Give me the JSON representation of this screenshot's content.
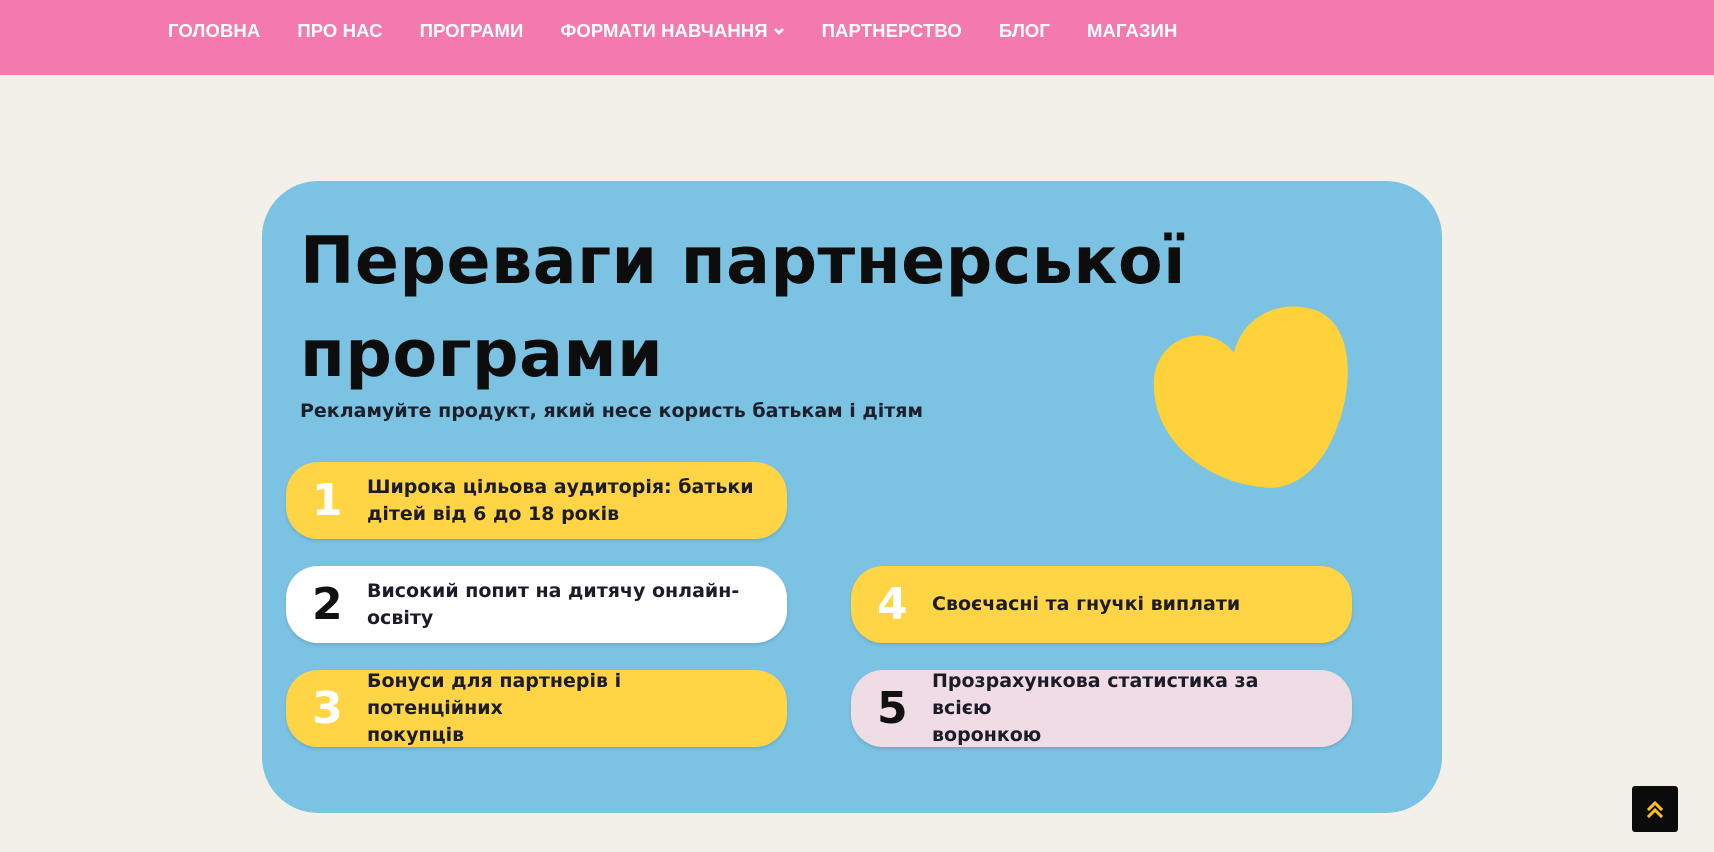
{
  "nav": {
    "items": [
      {
        "label": "ГОЛОВНА",
        "name": "nav-item-home",
        "dropdown": false
      },
      {
        "label": "ПРО НАС",
        "name": "nav-item-about",
        "dropdown": false
      },
      {
        "label": "ПРОГРАМИ",
        "name": "nav-item-programs",
        "dropdown": false
      },
      {
        "label": "ФОРМАТИ НАВЧАННЯ",
        "name": "nav-item-formats",
        "dropdown": true
      },
      {
        "label": "ПАРТНЕРСТВО",
        "name": "nav-item-partnership",
        "dropdown": false
      },
      {
        "label": "БЛОГ",
        "name": "nav-item-blog",
        "dropdown": false
      },
      {
        "label": "МАГАЗИН",
        "name": "nav-item-shop",
        "dropdown": false
      }
    ]
  },
  "banner": {
    "title": "Переваги партнерської програми",
    "subtitle": "Рекламуйте продукт, який несе користь батькам і дітям",
    "benefits": [
      {
        "number": "1",
        "text": "Широка цільова аудиторія: батьки\n дітей від 6 до 18 років",
        "style": "yellow"
      },
      {
        "number": "2",
        "text": "Високий попит на дитячу онлайн-\nосвіту",
        "style": "white"
      },
      {
        "number": "3",
        "text": "Бонуси для партнерів і потенційних\nпокупців",
        "style": "yellow"
      },
      {
        "number": "4",
        "text": "Своєчасні та гнучкі виплати",
        "style": "yellow"
      },
      {
        "number": "5",
        "text": "Прозрахункова статистика за всією\nворонкою",
        "style": "pink"
      }
    ]
  },
  "icons": {
    "heart": "heart-icon",
    "dropdown": "chevron-down-icon",
    "scroll_top": "double-chevron-up-icon"
  },
  "colors": {
    "nav_bg": "#f379ae",
    "page_bg": "#f3f0e9",
    "card_bg": "#7cc2e2",
    "accent_yellow": "#ffd445",
    "pill_pink": "#efdce4",
    "scroll_top_bg": "#0b0b0b",
    "scroll_top_icon": "#ffc21a"
  }
}
